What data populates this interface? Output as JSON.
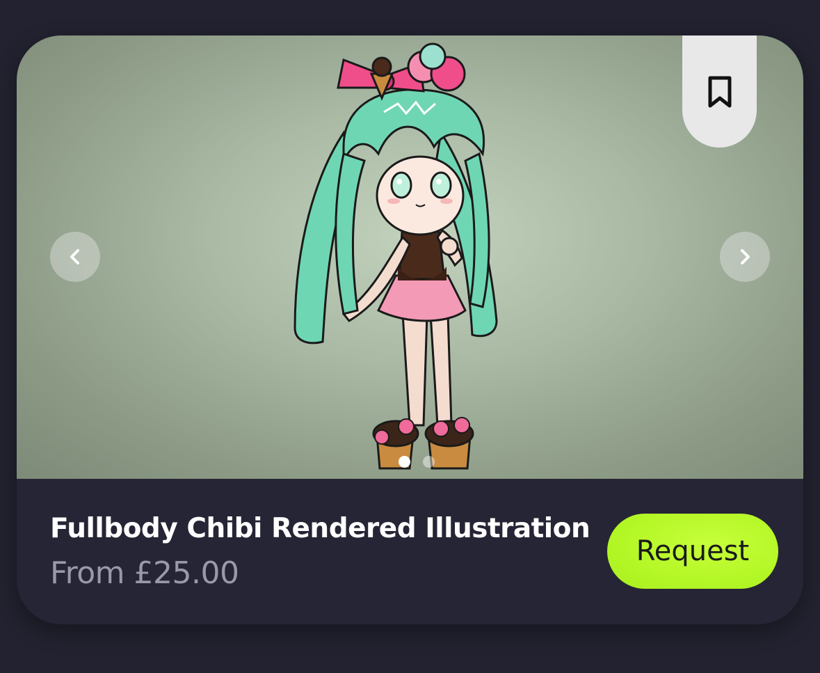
{
  "listing": {
    "title": "Fullbody Chibi Rendered Illustration",
    "price": "From £25.00",
    "request_label": "Request"
  },
  "carousel": {
    "image_count": 2,
    "active_index": 0
  },
  "icons": {
    "bookmark": "bookmark-icon",
    "prev": "chevron-left-icon",
    "next": "chevron-right-icon"
  },
  "colors": {
    "background": "#222230",
    "card": "#262535",
    "accent": "#b4f726",
    "title": "#ffffff",
    "price": "#9a99a8"
  }
}
